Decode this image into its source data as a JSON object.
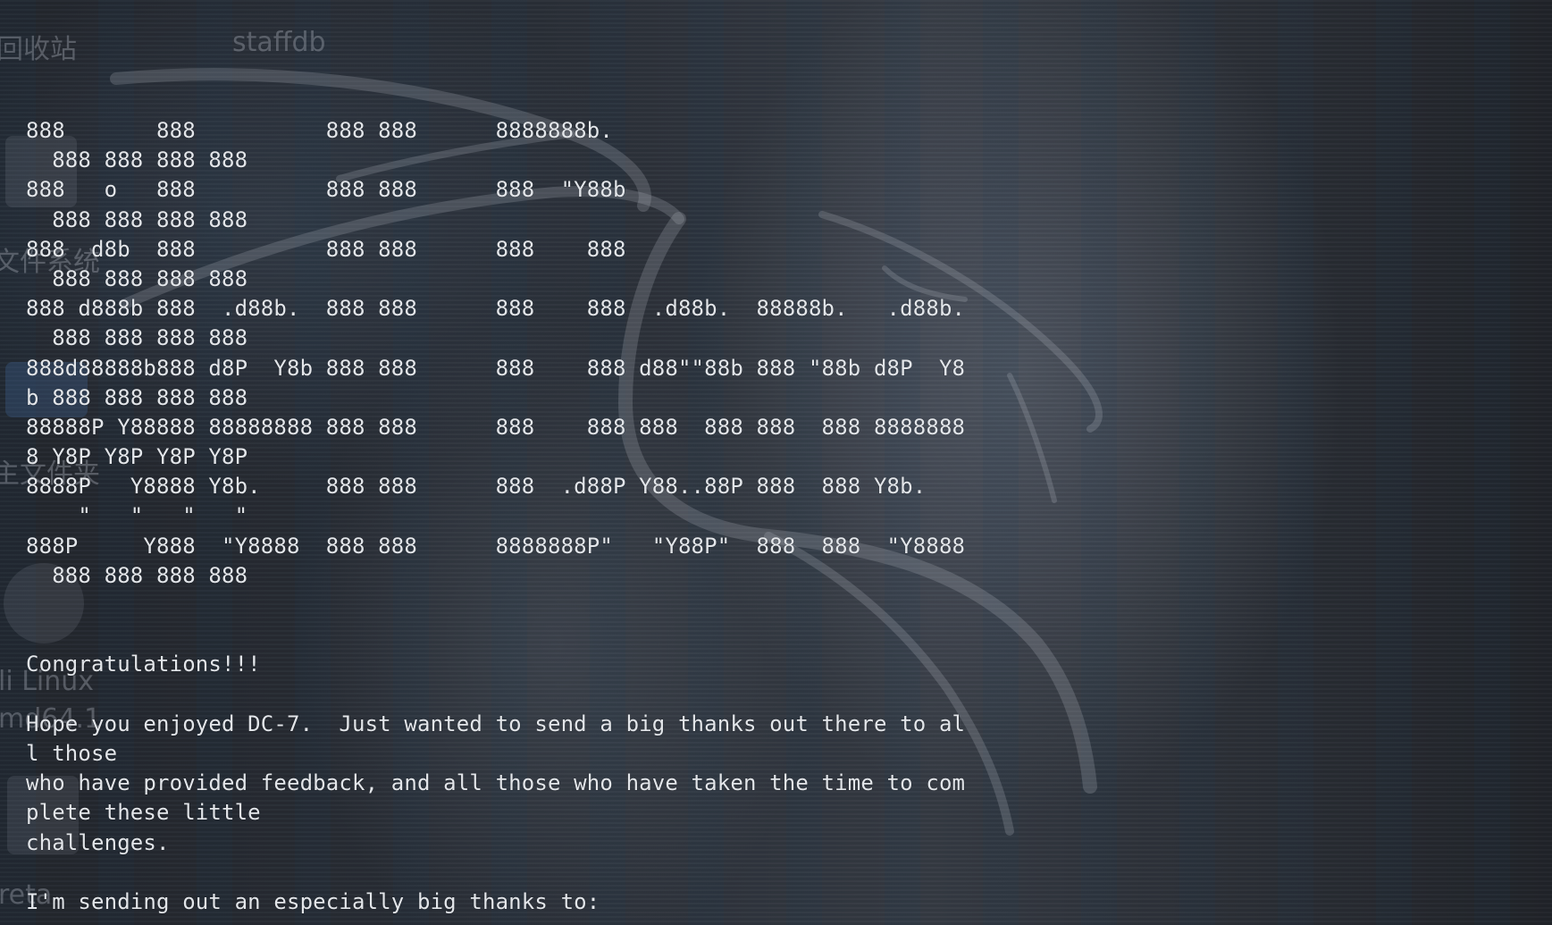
{
  "desktop": {
    "icons": [
      {
        "label": "回收站",
        "icon": "trash-icon"
      },
      {
        "label": "staffdb",
        "icon": "database-icon"
      },
      {
        "label": "文件系统",
        "icon": "filesystem-icon"
      },
      {
        "label": "主文件夹",
        "icon": "home-folder-icon"
      },
      {
        "label": "li Linux",
        "icon": "disc-icon"
      },
      {
        "label": "md64.1",
        "icon": ""
      },
      {
        "label": "reta",
        "icon": "document-icon"
      }
    ]
  },
  "terminal": {
    "lines": [
      "888       888          888 888      8888888b.",
      "  888 888 888 888",
      "888   o   888          888 888      888  \"Y88b",
      "  888 888 888 888",
      "888  d8b  888          888 888      888    888",
      "  888 888 888 888",
      "888 d888b 888  .d88b.  888 888      888    888  .d88b.  88888b.   .d88b.",
      "  888 888 888 888",
      "888d88888b888 d8P  Y8b 888 888      888    888 d88\"\"88b 888 \"88b d8P  Y8",
      "b 888 888 888 888",
      "88888P Y88888 88888888 888 888      888    888 888  888 888  888 8888888",
      "8 Y8P Y8P Y8P Y8P",
      "8888P   Y8888 Y8b.     888 888      888  .d88P Y88..88P 888  888 Y8b.",
      "    \"   \"   \"   \"",
      "888P     Y888  \"Y8888  888 888      8888888P\"   \"Y88P\"  888  888  \"Y8888",
      "  888 888 888 888",
      "",
      "",
      "Congratulations!!!",
      "",
      "Hope you enjoyed DC-7.  Just wanted to send a big thanks out there to al",
      "l those",
      "who have provided feedback, and all those who have taken the time to com",
      "plete these little",
      "challenges.",
      "",
      "I'm sending out an especially big thanks to:"
    ]
  }
}
